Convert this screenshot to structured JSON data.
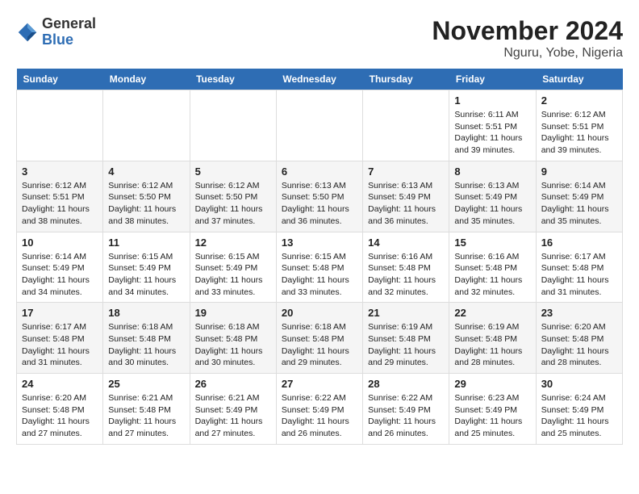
{
  "header": {
    "logo_general": "General",
    "logo_blue": "Blue",
    "month_title": "November 2024",
    "location": "Nguru, Yobe, Nigeria"
  },
  "weekdays": [
    "Sunday",
    "Monday",
    "Tuesday",
    "Wednesday",
    "Thursday",
    "Friday",
    "Saturday"
  ],
  "weeks": [
    [
      {
        "day": "",
        "info": ""
      },
      {
        "day": "",
        "info": ""
      },
      {
        "day": "",
        "info": ""
      },
      {
        "day": "",
        "info": ""
      },
      {
        "day": "",
        "info": ""
      },
      {
        "day": "1",
        "info": "Sunrise: 6:11 AM\nSunset: 5:51 PM\nDaylight: 11 hours\nand 39 minutes."
      },
      {
        "day": "2",
        "info": "Sunrise: 6:12 AM\nSunset: 5:51 PM\nDaylight: 11 hours\nand 39 minutes."
      }
    ],
    [
      {
        "day": "3",
        "info": "Sunrise: 6:12 AM\nSunset: 5:51 PM\nDaylight: 11 hours\nand 38 minutes."
      },
      {
        "day": "4",
        "info": "Sunrise: 6:12 AM\nSunset: 5:50 PM\nDaylight: 11 hours\nand 38 minutes."
      },
      {
        "day": "5",
        "info": "Sunrise: 6:12 AM\nSunset: 5:50 PM\nDaylight: 11 hours\nand 37 minutes."
      },
      {
        "day": "6",
        "info": "Sunrise: 6:13 AM\nSunset: 5:50 PM\nDaylight: 11 hours\nand 36 minutes."
      },
      {
        "day": "7",
        "info": "Sunrise: 6:13 AM\nSunset: 5:49 PM\nDaylight: 11 hours\nand 36 minutes."
      },
      {
        "day": "8",
        "info": "Sunrise: 6:13 AM\nSunset: 5:49 PM\nDaylight: 11 hours\nand 35 minutes."
      },
      {
        "day": "9",
        "info": "Sunrise: 6:14 AM\nSunset: 5:49 PM\nDaylight: 11 hours\nand 35 minutes."
      }
    ],
    [
      {
        "day": "10",
        "info": "Sunrise: 6:14 AM\nSunset: 5:49 PM\nDaylight: 11 hours\nand 34 minutes."
      },
      {
        "day": "11",
        "info": "Sunrise: 6:15 AM\nSunset: 5:49 PM\nDaylight: 11 hours\nand 34 minutes."
      },
      {
        "day": "12",
        "info": "Sunrise: 6:15 AM\nSunset: 5:49 PM\nDaylight: 11 hours\nand 33 minutes."
      },
      {
        "day": "13",
        "info": "Sunrise: 6:15 AM\nSunset: 5:48 PM\nDaylight: 11 hours\nand 33 minutes."
      },
      {
        "day": "14",
        "info": "Sunrise: 6:16 AM\nSunset: 5:48 PM\nDaylight: 11 hours\nand 32 minutes."
      },
      {
        "day": "15",
        "info": "Sunrise: 6:16 AM\nSunset: 5:48 PM\nDaylight: 11 hours\nand 32 minutes."
      },
      {
        "day": "16",
        "info": "Sunrise: 6:17 AM\nSunset: 5:48 PM\nDaylight: 11 hours\nand 31 minutes."
      }
    ],
    [
      {
        "day": "17",
        "info": "Sunrise: 6:17 AM\nSunset: 5:48 PM\nDaylight: 11 hours\nand 31 minutes."
      },
      {
        "day": "18",
        "info": "Sunrise: 6:18 AM\nSunset: 5:48 PM\nDaylight: 11 hours\nand 30 minutes."
      },
      {
        "day": "19",
        "info": "Sunrise: 6:18 AM\nSunset: 5:48 PM\nDaylight: 11 hours\nand 30 minutes."
      },
      {
        "day": "20",
        "info": "Sunrise: 6:18 AM\nSunset: 5:48 PM\nDaylight: 11 hours\nand 29 minutes."
      },
      {
        "day": "21",
        "info": "Sunrise: 6:19 AM\nSunset: 5:48 PM\nDaylight: 11 hours\nand 29 minutes."
      },
      {
        "day": "22",
        "info": "Sunrise: 6:19 AM\nSunset: 5:48 PM\nDaylight: 11 hours\nand 28 minutes."
      },
      {
        "day": "23",
        "info": "Sunrise: 6:20 AM\nSunset: 5:48 PM\nDaylight: 11 hours\nand 28 minutes."
      }
    ],
    [
      {
        "day": "24",
        "info": "Sunrise: 6:20 AM\nSunset: 5:48 PM\nDaylight: 11 hours\nand 27 minutes."
      },
      {
        "day": "25",
        "info": "Sunrise: 6:21 AM\nSunset: 5:48 PM\nDaylight: 11 hours\nand 27 minutes."
      },
      {
        "day": "26",
        "info": "Sunrise: 6:21 AM\nSunset: 5:49 PM\nDaylight: 11 hours\nand 27 minutes."
      },
      {
        "day": "27",
        "info": "Sunrise: 6:22 AM\nSunset: 5:49 PM\nDaylight: 11 hours\nand 26 minutes."
      },
      {
        "day": "28",
        "info": "Sunrise: 6:22 AM\nSunset: 5:49 PM\nDaylight: 11 hours\nand 26 minutes."
      },
      {
        "day": "29",
        "info": "Sunrise: 6:23 AM\nSunset: 5:49 PM\nDaylight: 11 hours\nand 25 minutes."
      },
      {
        "day": "30",
        "info": "Sunrise: 6:24 AM\nSunset: 5:49 PM\nDaylight: 11 hours\nand 25 minutes."
      }
    ]
  ]
}
